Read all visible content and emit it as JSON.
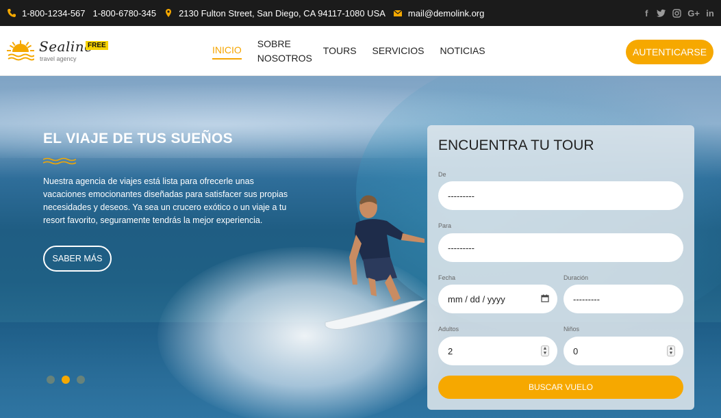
{
  "topbar": {
    "phone1": "1-800-1234-567",
    "phone2": "1-800-6780-345",
    "address": "2130 Fulton Street, San Diego, CA 94117-1080 USA",
    "email": "mail@demolink.org",
    "icon_color": "#f5a800",
    "social": [
      "f",
      "twitter",
      "instagram",
      "G+",
      "in"
    ]
  },
  "header": {
    "brand": "Sealine",
    "tagline": "travel agency",
    "badge": "FREE",
    "nav": [
      "INICIO",
      "SOBRE NOSOTROS",
      "TOURS",
      "SERVICIOS",
      "NOTICIAS"
    ],
    "login_label": "AUTENTICARSE"
  },
  "hero": {
    "title": "EL VIAJE DE TUS SUEÑOS",
    "text": "Nuestra agencia de viajes está lista para ofrecerle unas vacaciones emocionantes diseñadas para satisfacer sus propias necesidades y deseos. Ya sea un crucero exótico o un viaje a tu resort favorito, seguramente tendrás la mejor experiencia.",
    "more_label": "SABER MÁS",
    "slides": 3,
    "active_slide": 2
  },
  "form": {
    "title": "ENCUENTRA TU TOUR",
    "from_label": "De",
    "from_value": "---------",
    "to_label": "Para",
    "to_value": "---------",
    "date_label": "Fecha",
    "date_value": "mm / dd / yyyy",
    "duration_label": "Duración",
    "duration_value": "---------",
    "adults_label": "Adultos",
    "adults_value": "2",
    "kids_label": "Niños",
    "kids_value": "0",
    "search_label": "BUSCAR VUELO"
  },
  "colors": {
    "accent": "#f6a800",
    "dark": "#1b1b1b"
  }
}
